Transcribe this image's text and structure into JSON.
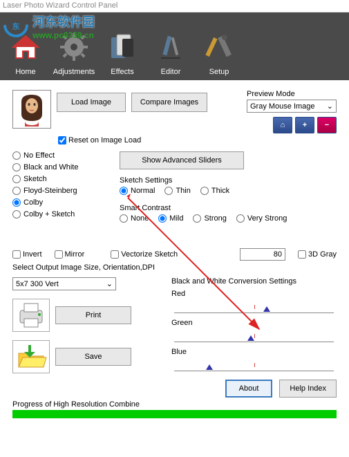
{
  "window": {
    "title": "Laser Photo Wizard Control Panel"
  },
  "watermark": {
    "site": "河东软件园",
    "url": "www.pc0359.cn"
  },
  "toolbar": {
    "home": "Home",
    "adjustments": "Adjustments",
    "effects": "Effects",
    "editor": "Editor",
    "setup": "Setup"
  },
  "buttons": {
    "load_image": "Load Image",
    "compare_images": "Compare Images",
    "show_advanced": "Show Advanced Sliders",
    "print": "Print",
    "save": "Save",
    "about": "About",
    "help_index": "Help Index"
  },
  "preview": {
    "label": "Preview Mode",
    "value": "Gray Mouse Image"
  },
  "checkboxes": {
    "reset_on_load": "Reset on Image Load",
    "invert": "Invert",
    "mirror": "Mirror",
    "vectorize": "Vectorize Sketch",
    "3d_gray": "3D Gray"
  },
  "effects": {
    "no_effect": "No Effect",
    "bw": "Black and White",
    "sketch": "Sketch",
    "floyd": "Floyd-Steinberg",
    "colby": "Colby",
    "colby_sketch": "Colby + Sketch"
  },
  "sketch_settings": {
    "label": "Sketch Settings",
    "normal": "Normal",
    "thin": "Thin",
    "thick": "Thick"
  },
  "smart_contrast": {
    "label": "Smart Contrast",
    "none": "None",
    "mild": "Mild",
    "strong": "Strong",
    "very_strong": "Very Strong"
  },
  "numeric": {
    "value": "80"
  },
  "output": {
    "label": "Select Output Image Size, Orientation,DPI",
    "value": "5x7 300 Vert"
  },
  "bw_conversion": {
    "label": "Black and White Conversion Settings",
    "red": "Red",
    "green": "Green",
    "blue": "Blue"
  },
  "progress": {
    "label": "Progress of High Resolution Combine"
  }
}
